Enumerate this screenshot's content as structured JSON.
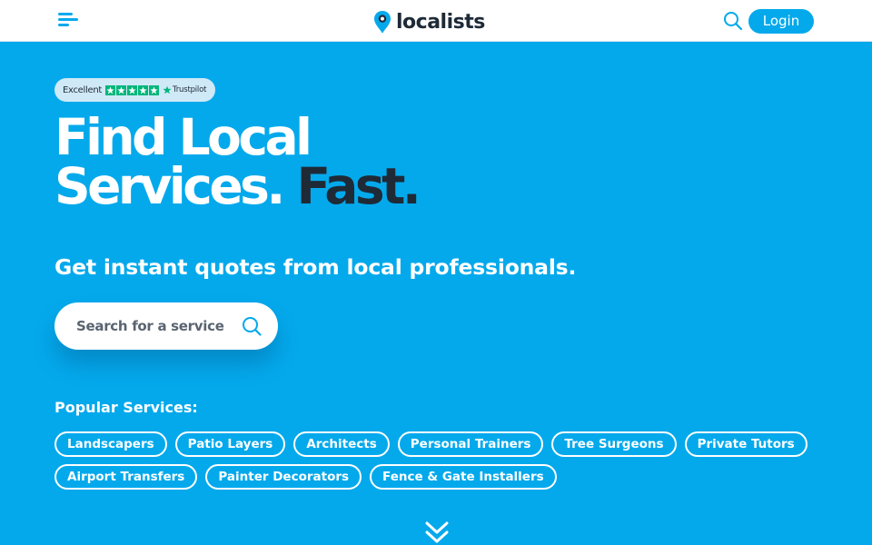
{
  "header": {
    "logo_text": "localists",
    "login_label": "Login",
    "icons": [
      "menu-icon",
      "location-pin-icon",
      "search-icon"
    ],
    "brand_color": "#04a9ec"
  },
  "trustpilot": {
    "label": "Excellent",
    "rating_stars": 5,
    "brand": "Trustpilot",
    "star_color": "#00b67a"
  },
  "hero": {
    "line1": "Find Local",
    "line2_white": "Services.",
    "line2_dark": "Fast.",
    "subheading": "Get instant quotes from local professionals."
  },
  "search": {
    "placeholder": "Search for a service"
  },
  "popular": {
    "label": "Popular Services:",
    "row1": [
      "Landscapers",
      "Patio Layers",
      "Architects",
      "Personal Trainers",
      "Tree Surgeons",
      "Private Tutors"
    ],
    "row2": [
      "Airport Transfers",
      "Painter Decorators",
      "Fence & Gate Installers"
    ]
  },
  "colors": {
    "background": "#04a9ec",
    "dark_text": "#1f2a37"
  }
}
